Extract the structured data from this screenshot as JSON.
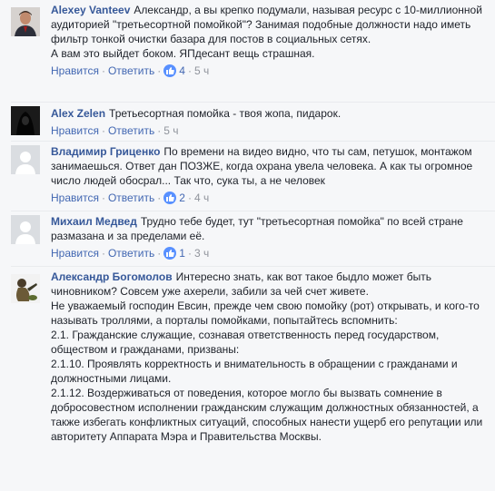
{
  "ui": {
    "like_label": "Нравится",
    "reply_label": "Ответить",
    "sep": "·",
    "like_icon": "thumbs-up-icon",
    "accent_color": "#365899",
    "link_color": "#4267b2",
    "meta_color": "#90949c"
  },
  "comments": [
    {
      "author": "Alexey Vanteev",
      "text": "Александр, а вы крепко подумали, называя ресурс с 10-миллионной аудиторией \"третьесортной помойкой\"? Занимая подобные должности надо иметь фильтр тонкой очистки базара для постов в социальных сетях.\nА вам это выйдет боком. ЯПдесант вещь страшная.",
      "likes": "4",
      "time": "5 ч"
    },
    {
      "author": "Alex Zelen",
      "text": "Третьесортная помойка - твоя жопа, пидарок.",
      "likes": "",
      "time": "5 ч"
    },
    {
      "author": "Владимир Гриценко",
      "text": "По времени на видео видно, что ты сам, петушок, монтажом занимаешься. Ответ дан ПОЗЖЕ, когда охрана увела человека. А как ты огромное число людей обосрал... Так что, сука ты, а не человек",
      "likes": "2",
      "time": "4 ч"
    },
    {
      "author": "Михаил Медвед",
      "text": "Трудно тебе будет, тут \"третьесортная помойка\" по всей стране размазана и за пределами её.",
      "likes": "1",
      "time": "3 ч"
    },
    {
      "author": "Александр Богомолов",
      "text": "Интересно знать, как вот такое быдло может быть чиновником? Совсем уже ахерели, забили за чей счет живете.\nНе уважаемый господин Евсин, прежде чем свою помойку (рот) открывать, и кого-то называть троллями, а порталы помойками, попытайтесь вспомнить:\n2.1. Гражданские служащие, сознавая ответственность перед государством, обществом и гражданами, призваны:\n2.1.10. Проявлять корректность и внимательность в обращении с гражданами и должностными лицами.\n2.1.12. Воздерживаться от поведения, которое могло бы вызвать сомнение в добросовестном исполнении гражданским служащим должностных обязанностей, а также избегать конфликтных ситуаций, способных нанести ущерб его репутации или авторитету Аппарата Мэра и Правительства Москвы.",
      "likes": "",
      "time": ""
    }
  ]
}
